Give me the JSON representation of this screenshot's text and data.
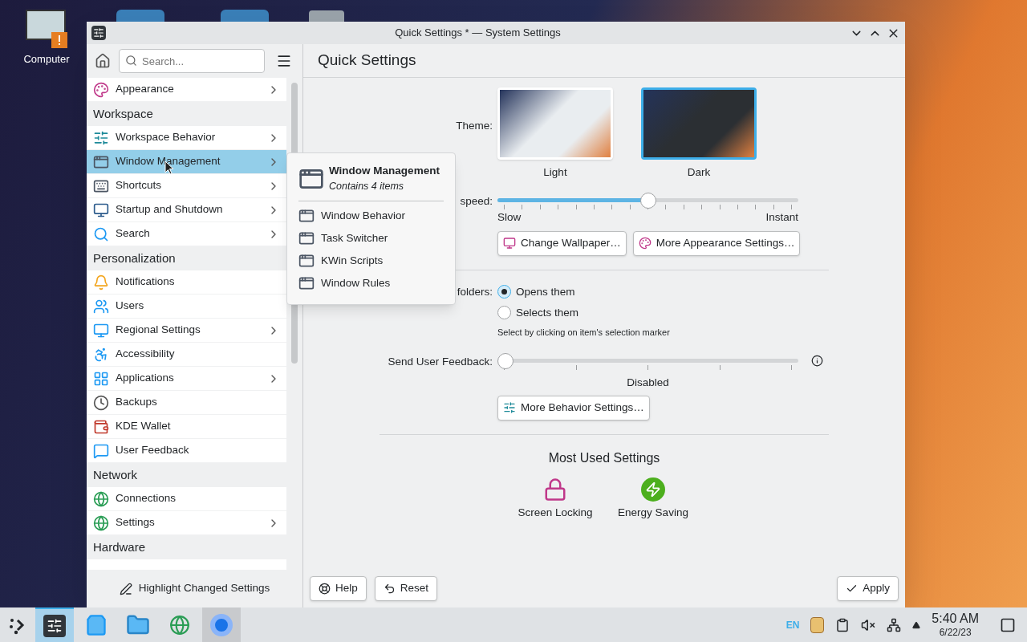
{
  "desktop": {
    "icons": [
      {
        "label": "Computer"
      }
    ]
  },
  "window": {
    "title": "Quick Settings * — System Settings"
  },
  "sidebar": {
    "search": {
      "placeholder": "Search..."
    },
    "items": [
      {
        "kind": "item",
        "label": "Appearance",
        "has_submenu": true,
        "selected": false
      },
      {
        "kind": "header",
        "label": "Workspace"
      },
      {
        "kind": "item",
        "label": "Workspace Behavior",
        "has_submenu": true,
        "selected": false
      },
      {
        "kind": "item",
        "label": "Window Management",
        "has_submenu": true,
        "selected": true
      },
      {
        "kind": "item",
        "label": "Shortcuts",
        "has_submenu": true,
        "selected": false
      },
      {
        "kind": "item",
        "label": "Startup and Shutdown",
        "has_submenu": true,
        "selected": false
      },
      {
        "kind": "item",
        "label": "Search",
        "has_submenu": true,
        "selected": false
      },
      {
        "kind": "header",
        "label": "Personalization"
      },
      {
        "kind": "item",
        "label": "Notifications",
        "has_submenu": false,
        "selected": false
      },
      {
        "kind": "item",
        "label": "Users",
        "has_submenu": false,
        "selected": false
      },
      {
        "kind": "item",
        "label": "Regional Settings",
        "has_submenu": true,
        "selected": false
      },
      {
        "kind": "item",
        "label": "Accessibility",
        "has_submenu": false,
        "selected": false
      },
      {
        "kind": "item",
        "label": "Applications",
        "has_submenu": true,
        "selected": false
      },
      {
        "kind": "item",
        "label": "Backups",
        "has_submenu": false,
        "selected": false
      },
      {
        "kind": "item",
        "label": "KDE Wallet",
        "has_submenu": false,
        "selected": false
      },
      {
        "kind": "item",
        "label": "User Feedback",
        "has_submenu": false,
        "selected": false
      },
      {
        "kind": "header",
        "label": "Network"
      },
      {
        "kind": "item",
        "label": "Connections",
        "has_submenu": false,
        "selected": false
      },
      {
        "kind": "item",
        "label": "Settings",
        "has_submenu": true,
        "selected": false
      },
      {
        "kind": "header",
        "label": "Hardware"
      }
    ],
    "footer": "Highlight Changed Settings"
  },
  "popup": {
    "title": "Window Management",
    "subtitle": "Contains 4 items",
    "items": [
      "Window Behavior",
      "Task Switcher",
      "KWin Scripts",
      "Window Rules"
    ]
  },
  "page": {
    "title": "Quick Settings",
    "theme": {
      "label": "Theme:",
      "options": [
        {
          "label": "Light",
          "selected": false
        },
        {
          "label": "Dark",
          "selected": true
        }
      ]
    },
    "animation": {
      "label": "speed:",
      "level": 0.5,
      "min_label": "Slow",
      "max_label": "Instant"
    },
    "appearance_buttons": [
      "Change Wallpaper…",
      "More Appearance Settings…"
    ],
    "clicking": {
      "label": "folders:",
      "options": [
        {
          "label": "Opens them",
          "selected": true
        },
        {
          "label": "Selects them",
          "selected": false
        }
      ],
      "hint": "Select by clicking on item's selection marker"
    },
    "feedback": {
      "label": "Send User Feedback:",
      "level": 0,
      "value_label": "Disabled"
    },
    "behavior_button": "More Behavior Settings…",
    "most_used": {
      "title": "Most Used Settings",
      "items": [
        "Screen Locking",
        "Energy Saving"
      ]
    },
    "buttons": [
      "Help",
      "Reset",
      "Apply"
    ]
  },
  "taskbar": {
    "apps": [
      {
        "selected": true,
        "hovered": false
      },
      {
        "selected": false,
        "hovered": false
      },
      {
        "selected": false,
        "hovered": false
      },
      {
        "selected": false,
        "hovered": false
      },
      {
        "selected": false,
        "hovered": true
      }
    ],
    "keyboard_layout": "EN",
    "time": "5:40 AM",
    "date": "6/22/23"
  }
}
